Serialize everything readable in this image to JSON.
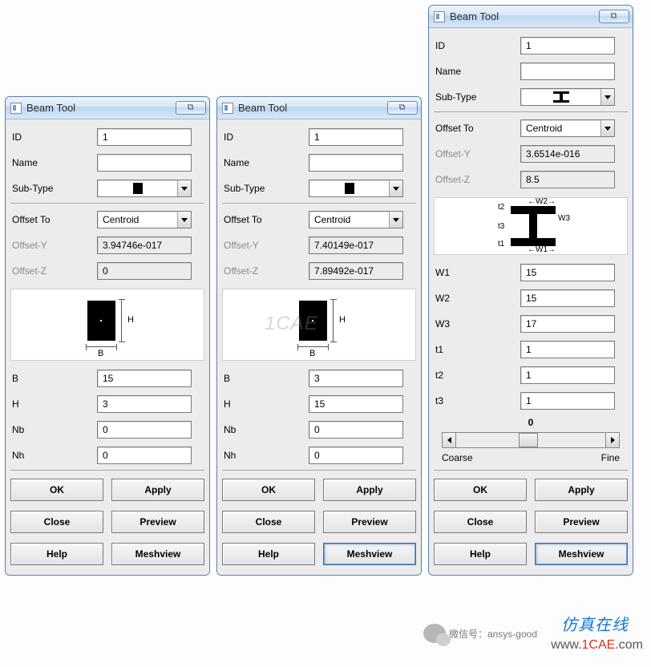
{
  "title": "Beam Tool",
  "close_glyph": "⌇",
  "labels": {
    "id": "ID",
    "name": "Name",
    "subtype": "Sub-Type",
    "offset_to": "Offset To",
    "offset_y": "Offset-Y",
    "offset_z": "Offset-Z",
    "coarse": "Coarse",
    "fine": "Fine"
  },
  "offset_options": {
    "centroid": "Centroid"
  },
  "params_rect": {
    "B": "B",
    "H": "H",
    "Nb": "Nb",
    "Nh": "Nh"
  },
  "params_i": {
    "W1": "W1",
    "W2": "W2",
    "W3": "W3",
    "t1": "t1",
    "t2": "t2",
    "t3": "t3"
  },
  "diag": {
    "H": "H",
    "B": "B",
    "t1": "t1",
    "t2": "t2",
    "t3": "t3",
    "W1": "W1",
    "W2": "W2",
    "W3": "W3"
  },
  "buttons": {
    "ok": "OK",
    "apply": "Apply",
    "close": "Close",
    "preview": "Preview",
    "help": "Help",
    "meshview": "Meshview"
  },
  "slider": {
    "value": "0"
  },
  "win1": {
    "id": "1",
    "name": "",
    "offset_to": "Centroid",
    "offset_y": "3.94746e-017",
    "offset_z": "0",
    "B": "15",
    "H": "3",
    "Nb": "0",
    "Nh": "0"
  },
  "win2": {
    "id": "1",
    "name": "",
    "offset_to": "Centroid",
    "offset_y": "7.40149e-017",
    "offset_z": "7.89492e-017",
    "B": "3",
    "H": "15",
    "Nb": "0",
    "Nh": "0"
  },
  "win3": {
    "id": "1",
    "name": "",
    "offset_to": "Centroid",
    "offset_y": "3.6514e-016",
    "offset_z": "8.5",
    "W1": "15",
    "W2": "15",
    "W3": "17",
    "t1": "1",
    "t2": "1",
    "t3": "1"
  },
  "watermark": "1CAE",
  "wechat_label": "微信号：ansys-good",
  "footer_cn": "仿真在线",
  "footer_url": {
    "prefix": "www.",
    "mid": "1CAE",
    "suffix": ".com"
  }
}
